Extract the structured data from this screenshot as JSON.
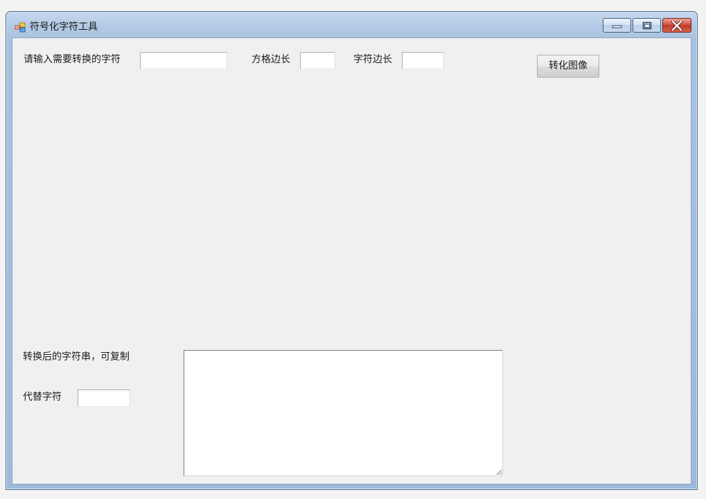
{
  "window": {
    "title": "符号化字符工具",
    "icon": "app-form-icon",
    "controls": {
      "minimize_icon": "minimize-icon",
      "maximize_icon": "maximize-icon",
      "close_icon": "close-icon"
    }
  },
  "form": {
    "input_label": "请输入需要转换的字符",
    "input_value": "",
    "grid_label": "方格边长",
    "grid_value": "",
    "char_size_label": "字符边长",
    "char_size_value": "",
    "convert_button": "转化图像",
    "output_label": "转换后的字符串，可复制",
    "replace_label": "代替字符",
    "replace_value": "",
    "output_value": ""
  },
  "colors": {
    "title_bar": "#a9c2df",
    "client_background": "#f0f0f0",
    "close_button": "#c03a25"
  }
}
